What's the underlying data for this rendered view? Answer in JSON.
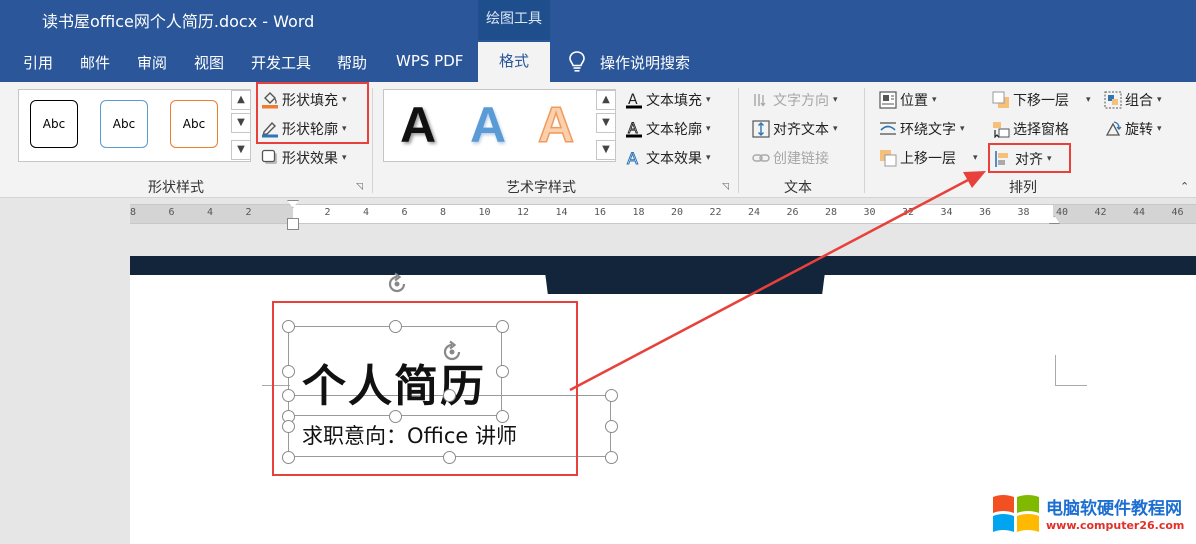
{
  "window": {
    "title": "读书屋office网个人简历.docx  -  Word",
    "context_tab_group": "绘图工具"
  },
  "tabs": [
    {
      "label": "引用"
    },
    {
      "label": "邮件"
    },
    {
      "label": "审阅"
    },
    {
      "label": "视图"
    },
    {
      "label": "开发工具"
    },
    {
      "label": "帮助"
    },
    {
      "label": "WPS PDF"
    },
    {
      "label": "格式",
      "active": true
    }
  ],
  "search": {
    "label": "操作说明搜索",
    "icon": "lightbulb-icon"
  },
  "ribbon": {
    "shape_styles": {
      "label": "形状样式",
      "presets": [
        {
          "text": "Abc",
          "border": "#000000"
        },
        {
          "text": "Abc",
          "border": "#5b9bd5"
        },
        {
          "text": "Abc",
          "border": "#ed7d31"
        }
      ],
      "commands": [
        {
          "label": "形状填充",
          "icon": "paint-bucket-icon",
          "color": "#ed7d31"
        },
        {
          "label": "形状轮廓",
          "icon": "pencil-outline-icon",
          "color": "#2e75b6"
        },
        {
          "label": "形状效果",
          "icon": "shape-effects-icon"
        }
      ]
    },
    "wordart_styles": {
      "label": "艺术字样式",
      "letters": [
        {
          "text": "A",
          "style": "black"
        },
        {
          "text": "A",
          "style": "blue"
        },
        {
          "text": "A",
          "style": "orange"
        }
      ],
      "commands": [
        {
          "label": "文本填充",
          "icon": "text-fill-icon"
        },
        {
          "label": "文本轮廓",
          "icon": "text-outline-icon"
        },
        {
          "label": "文本效果",
          "icon": "text-effects-icon"
        }
      ]
    },
    "text": {
      "label": "文本",
      "commands": [
        {
          "label": "文字方向",
          "icon": "text-direction-icon",
          "enabled": false
        },
        {
          "label": "对齐文本",
          "icon": "align-text-icon",
          "enabled": true
        },
        {
          "label": "创建链接",
          "icon": "link-icon",
          "enabled": false
        }
      ]
    },
    "arrange": {
      "label": "排列",
      "commands": [
        {
          "label": "位置",
          "icon": "position-icon"
        },
        {
          "label": "环绕文字",
          "icon": "wrap-text-icon"
        },
        {
          "label": "上移一层",
          "icon": "bring-forward-icon"
        },
        {
          "label": "下移一层",
          "icon": "send-backward-icon"
        },
        {
          "label": "选择窗格",
          "icon": "selection-pane-icon"
        },
        {
          "label": "对齐",
          "icon": "align-icon"
        },
        {
          "label": "组合",
          "icon": "group-icon"
        },
        {
          "label": "旋转",
          "icon": "rotate-icon"
        }
      ]
    }
  },
  "ruler": {
    "labels": [
      "8",
      "6",
      "4",
      "2",
      "2",
      "4",
      "6",
      "8",
      "10",
      "12",
      "14",
      "16",
      "18",
      "20",
      "22",
      "24",
      "26",
      "28",
      "30",
      "32",
      "34",
      "36",
      "38",
      "40",
      "42",
      "44",
      "46"
    ]
  },
  "document": {
    "title": "个人简历",
    "subtitle": "求职意向：Office 讲师"
  },
  "watermark": {
    "line1": "电脑软硬件教程网",
    "line2": "www.computer26.com"
  },
  "colors": {
    "ribbon_blue": "#2b579a",
    "highlight_red": "#e8413c",
    "page_band": "#13253a"
  }
}
